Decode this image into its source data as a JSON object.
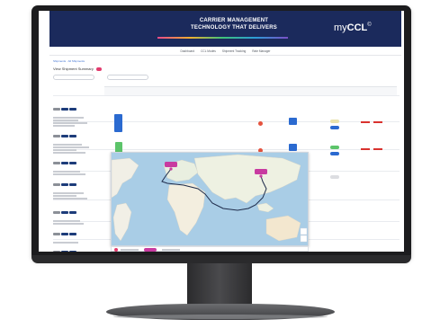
{
  "banner": {
    "title_line1": "CARRIER MANAGEMENT",
    "title_line2": "TECHNOLOGY THAT DELIVERS",
    "logo_prefix": "my",
    "logo_brand": "CCL",
    "colors": {
      "banner": "#1b2a5c",
      "accent_pink": "#e23a6d",
      "green": "#5cc46a",
      "blue": "#2b6ad0"
    }
  },
  "nav": {
    "items": [
      "Dashboard",
      "CCL Modes",
      "Shipment Tracking",
      "Rate Manager"
    ]
  },
  "page": {
    "breadcrumb": "Shipments · All Shipments",
    "title": "View Shipment Summary"
  },
  "icons": [
    "route-start-pin-icon",
    "route-end-pin-icon",
    "zoom-in-icon",
    "zoom-out-icon"
  ]
}
